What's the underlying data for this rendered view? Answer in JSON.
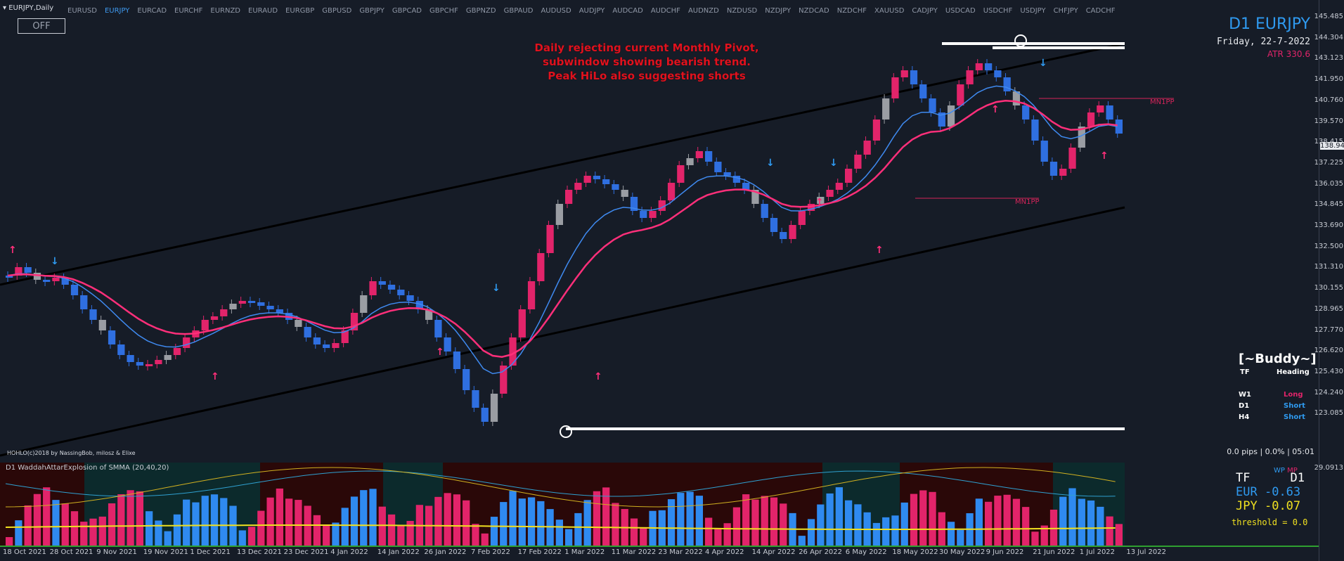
{
  "window": {
    "title": "EURJPY,Daily",
    "menu_icon": "triangle-down-icon"
  },
  "symbol_tabs": [
    "EURUSD",
    "EURJPY",
    "EURCAD",
    "EURCHF",
    "EURNZD",
    "EURAUD",
    "EURGBP",
    "GBPUSD",
    "GBPJPY",
    "GBPCAD",
    "GBPCHF",
    "GBPNZD",
    "GBPAUD",
    "AUDUSD",
    "AUDJPY",
    "AUDCAD",
    "AUDCHF",
    "AUDNZD",
    "NZDUSD",
    "NZDJPY",
    "NZDCAD",
    "NZDCHF",
    "XAUUSD",
    "CADJPY",
    "USDCAD",
    "USDCHF",
    "USDJPY",
    "CHFJPY",
    "CADCHF"
  ],
  "active_symbol": "EURJPY",
  "off_button": "OFF",
  "annotation": [
    "Daily rejecting current Monthly Pivot,",
    "subwindow showing bearish trend.",
    "Peak HiLo also suggesting shorts"
  ],
  "info": {
    "symbol": "D1 EURJPY",
    "date": "Friday, 22-7-2022",
    "atr": "ATR 330.6"
  },
  "buddy": {
    "title": "[~Buddy~]",
    "col_tf": "TF",
    "col_heading": "Heading",
    "rows": [
      {
        "tf": "W1",
        "heading": "Long",
        "color": "#e2246a"
      },
      {
        "tf": "D1",
        "heading": "Short",
        "color": "#2f9af0"
      },
      {
        "tf": "H4",
        "heading": "Short",
        "color": "#2f9af0"
      }
    ]
  },
  "pips_status": "0.0 pips | 0.0% | 05:01",
  "copyright": "HOHLO(c)2018 by NassingBob, milosz & Elixe",
  "pivot_labels": [
    "MN1PP",
    "MN1PP"
  ],
  "price_axis": [
    "145.485",
    "144.304",
    "143.123",
    "141.950",
    "140.760",
    "139.570",
    "138.415",
    "137.225",
    "136.035",
    "134.845",
    "133.690",
    "132.500",
    "131.310",
    "130.155",
    "128.965",
    "127.770",
    "126.620",
    "125.430",
    "124.240",
    "123.085"
  ],
  "current_price": "138.944",
  "time_axis": [
    "18 Oct 2021",
    "28 Oct 2021",
    "9 Nov 2021",
    "19 Nov 2021",
    "1 Dec 2021",
    "13 Dec 2021",
    "23 Dec 2021",
    "4 Jan 2022",
    "14 Jan 2022",
    "26 Jan 2022",
    "7 Feb 2022",
    "17 Feb 2022",
    "1 Mar 2022",
    "11 Mar 2022",
    "23 Mar 2022",
    "4 Apr 2022",
    "14 Apr 2022",
    "26 Apr 2022",
    "6 May 2022",
    "18 May 2022",
    "30 May 2022",
    "9 Jun 2022",
    "21 Jun 2022",
    "1 Jul 2022",
    "13 Jul 2022"
  ],
  "subwindow": {
    "title": "D1 WaddahAttarExplosion of SMMA (20,40,20)",
    "max_value": "29.0913",
    "wp": "WP",
    "mp": "MP",
    "tf_label": "TF",
    "tf_value": "D1",
    "eur_label": "EUR",
    "eur_value": "-0.63",
    "jpy_label": "JPY",
    "jpy_value": "-0.07",
    "threshold": "threshold = 0.0"
  },
  "colors": {
    "bull": "#e2246a",
    "bear": "#2f6fe0",
    "neutral": "#9a9da3",
    "ma_fast": "#3f8af0",
    "ma_slow": "#ff2f7a",
    "bg": "#161c27"
  }
}
